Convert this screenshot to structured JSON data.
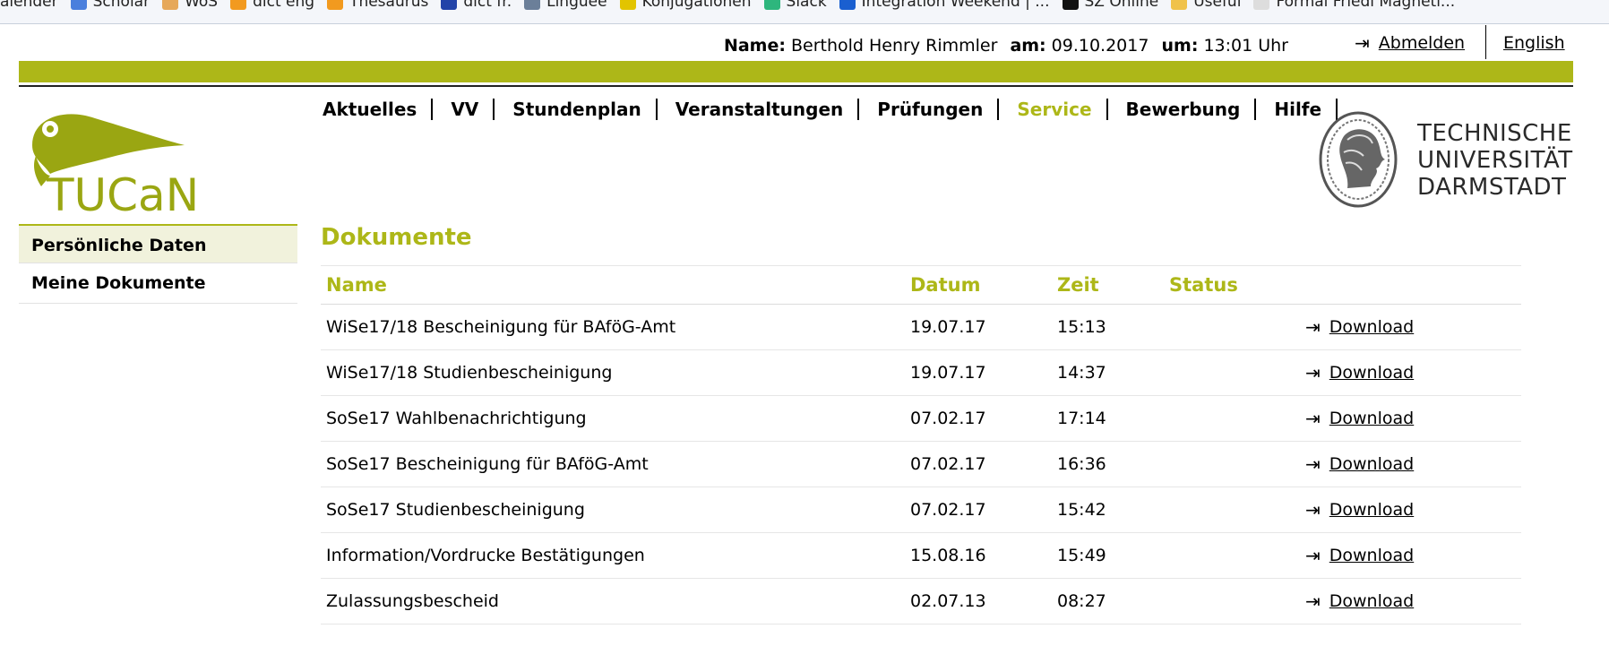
{
  "bookmarks": [
    {
      "label": "alender",
      "icon": "none",
      "color": "#ffffff"
    },
    {
      "label": "Scholar",
      "icon": "scholar-icon",
      "color": "#4a7fdd"
    },
    {
      "label": "WoS",
      "icon": "wos-icon",
      "color": "#e6a85a"
    },
    {
      "label": "dict eng",
      "icon": "dict-eng-icon",
      "color": "#f29a1f"
    },
    {
      "label": "Thesaurus",
      "icon": "thesaurus-icon",
      "color": "#f29a1f"
    },
    {
      "label": "dict fr.",
      "icon": "french-flag-icon",
      "color": "#2243a8"
    },
    {
      "label": "Linguee",
      "icon": "linguee-icon",
      "color": "#6b7f99"
    },
    {
      "label": "Konjugationen",
      "icon": "konjugationen-icon",
      "color": "#e2c400"
    },
    {
      "label": "Slack",
      "icon": "slack-icon",
      "color": "#2eb67d"
    },
    {
      "label": "Integration Weekend | ...",
      "icon": "integration-icon",
      "color": "#1a5fd0"
    },
    {
      "label": "SZ Online",
      "icon": "sz-icon",
      "color": "#111111"
    },
    {
      "label": "Useful",
      "icon": "folder-icon",
      "color": "#f0c24a"
    },
    {
      "label": "Formal Friedl Magnetl...",
      "icon": "page-icon",
      "color": "#dddddd"
    }
  ],
  "userbar": {
    "name_label": "Name:",
    "name_value": "Berthold Henry Rimmler",
    "date_label": "am:",
    "date_value": "09.10.2017",
    "time_label": "um:",
    "time_value": "13:01 Uhr",
    "logout": "Abmelden",
    "language": "English"
  },
  "logo_text": "TUCaN",
  "nav": [
    {
      "label": "Aktuelles",
      "active": false
    },
    {
      "label": "VV",
      "active": false
    },
    {
      "label": "Stundenplan",
      "active": false
    },
    {
      "label": "Veranstaltungen",
      "active": false
    },
    {
      "label": "Prüfungen",
      "active": false
    },
    {
      "label": "Service",
      "active": true
    },
    {
      "label": "Bewerbung",
      "active": false
    },
    {
      "label": "Hilfe",
      "active": false
    }
  ],
  "university": {
    "line1": "TECHNISCHE",
    "line2": "UNIVERSITÄT",
    "line3": "DARMSTADT"
  },
  "sidebar": {
    "items": [
      {
        "label": "Persönliche Daten",
        "active": true
      },
      {
        "label": "Meine Dokumente",
        "active": false
      }
    ]
  },
  "main": {
    "title": "Dokumente",
    "columns": [
      "Name",
      "Datum",
      "Zeit",
      "Status"
    ],
    "download_label": "Download",
    "rows": [
      {
        "name": "WiSe17/18 Bescheinigung für BAföG-Amt",
        "date": "19.07.17",
        "time": "15:13",
        "status": ""
      },
      {
        "name": "WiSe17/18 Studienbescheinigung",
        "date": "19.07.17",
        "time": "14:37",
        "status": ""
      },
      {
        "name": "SoSe17 Wahlbenachrichtigung",
        "date": "07.02.17",
        "time": "17:14",
        "status": ""
      },
      {
        "name": "SoSe17 Bescheinigung für BAföG-Amt",
        "date": "07.02.17",
        "time": "16:36",
        "status": ""
      },
      {
        "name": "SoSe17 Studienbescheinigung",
        "date": "07.02.17",
        "time": "15:42",
        "status": ""
      },
      {
        "name": "Information/Vordrucke Bestätigungen",
        "date": "15.08.16",
        "time": "15:49",
        "status": ""
      },
      {
        "name": "Zulassungsbescheid",
        "date": "02.07.13",
        "time": "08:27",
        "status": ""
      }
    ]
  },
  "colors": {
    "accent": "#adb718",
    "active_bg": "#f1f2dc"
  }
}
